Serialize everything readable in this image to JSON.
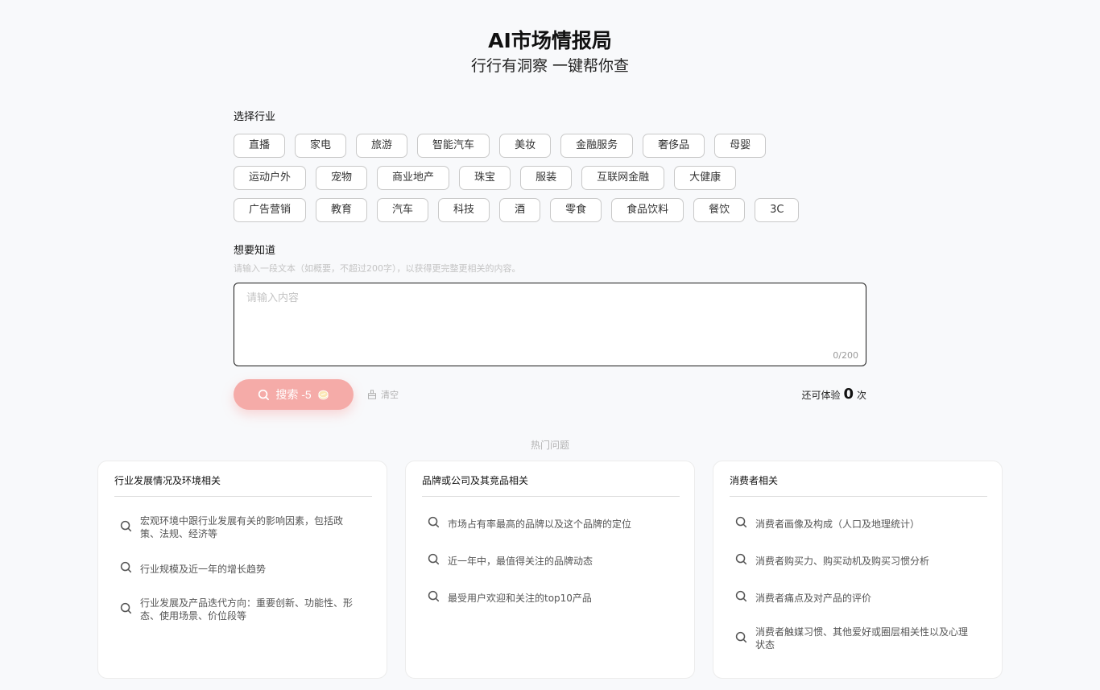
{
  "header": {
    "title": "AI市场情报局",
    "subtitle": "行行有洞察 一键帮你查"
  },
  "industry": {
    "label": "选择行业",
    "rows": [
      [
        "直播",
        "家电",
        "旅游",
        "智能汽车",
        "美妆",
        "金融服务",
        "奢侈品",
        "母婴"
      ],
      [
        "运动户外",
        "宠物",
        "商业地产",
        "珠宝",
        "服装",
        "互联网金融",
        "大健康"
      ],
      [
        "广告营销",
        "教育",
        "汽车",
        "科技",
        "酒",
        "零食",
        "食品饮料",
        "餐饮",
        "3C"
      ]
    ]
  },
  "query": {
    "label": "想要知道",
    "hint": "请输入一段文本（如概要，不超过200字），以获得更完整更相关的内容。",
    "placeholder": "请输入内容",
    "value": "",
    "counter": "0/200"
  },
  "actions": {
    "search_label": "搜索 -5",
    "coin_icon": "coin-icon",
    "clear_label": "清空",
    "remaining_prefix": "还可体验",
    "remaining_count": "0",
    "remaining_suffix": "次",
    "search_color": "#f5aba8"
  },
  "hot": {
    "label": "热门问题",
    "cards": [
      {
        "title": "行业发展情况及环境相关",
        "items": [
          "宏观环境中跟行业发展有关的影响因素，包括政策、法规、经济等",
          "行业规模及近一年的增长趋势",
          "行业发展及产品迭代方向：重要创新、功能性、形态、使用场景、价位段等"
        ]
      },
      {
        "title": "品牌或公司及其竞品相关",
        "items": [
          "市场占有率最高的品牌以及这个品牌的定位",
          "近一年中，最值得关注的品牌动态",
          "最受用户欢迎和关注的top10产品"
        ]
      },
      {
        "title": "消费者相关",
        "items": [
          "消费者画像及构成（人口及地理统计）",
          "消费者购买力、购买动机及购买习惯分析",
          "消费者痛点及对产品的评价",
          "消费者触媒习惯、其他爱好或圈层相关性以及心理状态"
        ]
      }
    ]
  }
}
